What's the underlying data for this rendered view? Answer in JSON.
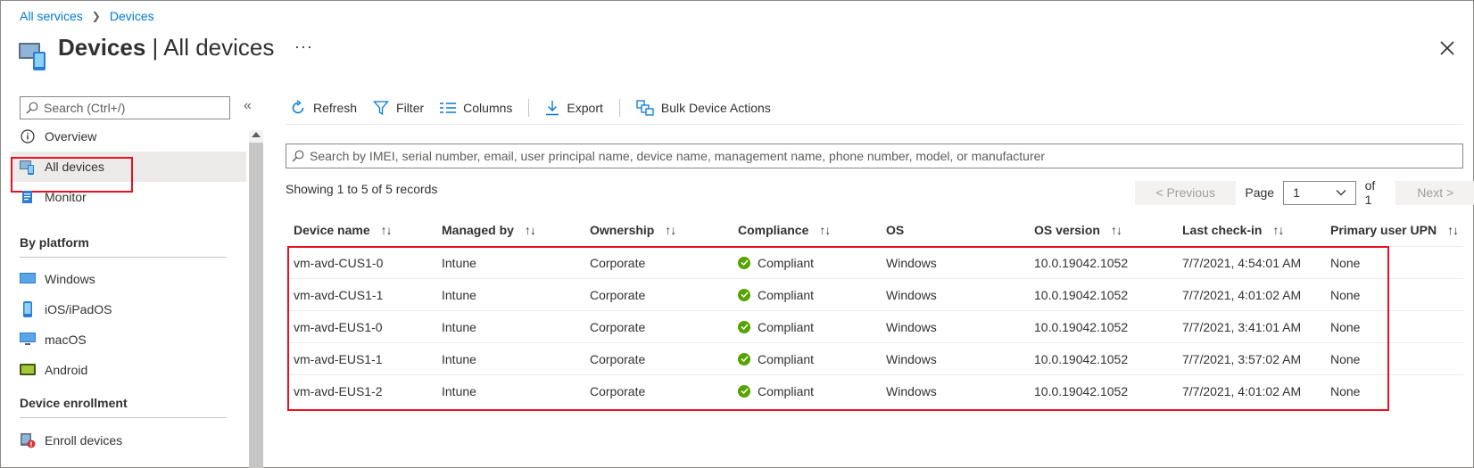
{
  "breadcrumb": {
    "root": "All services",
    "current": "Devices"
  },
  "header": {
    "title_bold": "Devices",
    "title_separator": " | ",
    "title_rest": "All devices",
    "more": "···",
    "icon": "devices-icon"
  },
  "sidebar": {
    "search_placeholder": "Search (Ctrl+/)",
    "collapse": "«",
    "items": [
      {
        "label": "Overview",
        "icon": "info-icon"
      },
      {
        "label": "All devices",
        "icon": "devices-icon",
        "active": true
      },
      {
        "label": "Monitor",
        "icon": "monitor-icon"
      }
    ],
    "sections": [
      {
        "title": "By platform",
        "items": [
          {
            "label": "Windows",
            "icon": "windows-icon"
          },
          {
            "label": "iOS/iPadOS",
            "icon": "ios-icon"
          },
          {
            "label": "macOS",
            "icon": "macos-icon"
          },
          {
            "label": "Android",
            "icon": "android-icon"
          }
        ]
      },
      {
        "title": "Device enrollment",
        "items": [
          {
            "label": "Enroll devices",
            "icon": "enroll-icon"
          }
        ]
      }
    ]
  },
  "toolbar": {
    "refresh": "Refresh",
    "filter": "Filter",
    "columns": "Columns",
    "export": "Export",
    "bulk": "Bulk Device Actions"
  },
  "main": {
    "search_placeholder": "Search by IMEI, serial number, email, user principal name, device name, management name, phone number, model, or manufacturer",
    "records_text": "Showing 1 to 5 of 5 records",
    "pager": {
      "previous": "< Previous",
      "page_label": "Page",
      "page_value": "1",
      "of": "of 1",
      "next": "Next >"
    }
  },
  "table": {
    "columns": [
      "Device name",
      "Managed by",
      "Ownership",
      "Compliance",
      "OS",
      "OS version",
      "Last check-in",
      "Primary user UPN"
    ],
    "sort_glyph": "↑↓",
    "rows": [
      {
        "device": "vm-avd-CUS1-0",
        "managed": "Intune",
        "ownership": "Corporate",
        "compliance": "Compliant",
        "os": "Windows",
        "version": "10.0.19042.1052",
        "checkin": "7/7/2021, 4:54:01 AM",
        "upn": "None"
      },
      {
        "device": "vm-avd-CUS1-1",
        "managed": "Intune",
        "ownership": "Corporate",
        "compliance": "Compliant",
        "os": "Windows",
        "version": "10.0.19042.1052",
        "checkin": "7/7/2021, 4:01:02 AM",
        "upn": "None"
      },
      {
        "device": "vm-avd-EUS1-0",
        "managed": "Intune",
        "ownership": "Corporate",
        "compliance": "Compliant",
        "os": "Windows",
        "version": "10.0.19042.1052",
        "checkin": "7/7/2021, 3:41:01 AM",
        "upn": "None"
      },
      {
        "device": "vm-avd-EUS1-1",
        "managed": "Intune",
        "ownership": "Corporate",
        "compliance": "Compliant",
        "os": "Windows",
        "version": "10.0.19042.1052",
        "checkin": "7/7/2021, 3:57:02 AM",
        "upn": "None"
      },
      {
        "device": "vm-avd-EUS1-2",
        "managed": "Intune",
        "ownership": "Corporate",
        "compliance": "Compliant",
        "os": "Windows",
        "version": "10.0.19042.1052",
        "checkin": "7/7/2021, 4:01:02 AM",
        "upn": "None"
      }
    ]
  },
  "colors": {
    "accent": "#0078d4",
    "highlight": "#e81123",
    "compliant": "#57a300"
  }
}
